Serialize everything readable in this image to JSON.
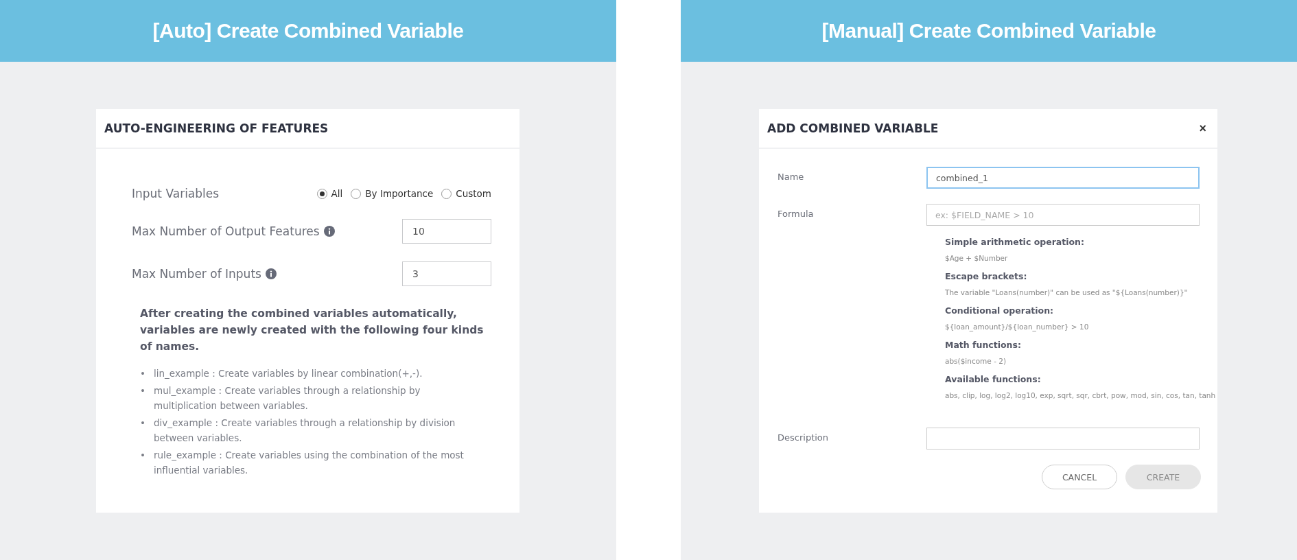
{
  "panels": [
    {
      "banner": "[Auto] Create Combined Variable",
      "dialog": {
        "title": "AUTO-ENGINEERING OF FEATURES",
        "input_variables": {
          "label": "Input Variables",
          "options": [
            {
              "label": "All",
              "selected": true
            },
            {
              "label": "By Importance",
              "selected": false
            },
            {
              "label": "Custom",
              "selected": false
            }
          ]
        },
        "number_fields": [
          {
            "label": "Max Number of Output Features",
            "value": "10"
          },
          {
            "label": "Max Number of Inputs",
            "value": "3"
          }
        ],
        "note": "After creating the combined variables automatically, variables are newly created with the following four kinds of names.",
        "examples": [
          {
            "marker": "•",
            "text": "lin_example : Create variables by linear combination(+,-)."
          },
          {
            "marker": "•",
            "text": "mul_example : Create variables through a relationship by multiplication between variables."
          },
          {
            "marker": "•",
            "text": "div_example : Create variables through a relationship by division between variables."
          },
          {
            "marker": "•",
            "text": "rule_example : Create variables using the combination of the most influential variables."
          }
        ]
      }
    },
    {
      "banner": "[Manual] Create Combined Variable",
      "dialog": {
        "title": "ADD COMBINED VARIABLE",
        "close": "×",
        "name_field": {
          "label": "Name",
          "value": "combined_1",
          "focused": true
        },
        "formula_field": {
          "label": "Formula",
          "placeholder": "ex: $FIELD_NAME > 10"
        },
        "hints": [
          {
            "title": "Simple arithmetic operation:",
            "text": "$Age + $Number"
          },
          {
            "title": "Escape brackets:",
            "text": "The variable \"Loans(number)\" can be used as \"${Loans(number)}\""
          },
          {
            "title": "Conditional operation:",
            "text": "${loan_amount}/${loan_number} > 10"
          },
          {
            "title": "Math functions:",
            "text": "abs($income - 2)"
          },
          {
            "title": "Available functions:",
            "text": "abs, clip, log, log2, log10, exp, sqrt, sqr, cbrt, pow, mod, sin, cos, tan, tanh"
          }
        ],
        "description_field": {
          "label": "Description"
        },
        "buttons": [
          {
            "label": "CANCEL",
            "disabled": false
          },
          {
            "label": "CREATE",
            "disabled": true
          }
        ]
      }
    }
  ]
}
